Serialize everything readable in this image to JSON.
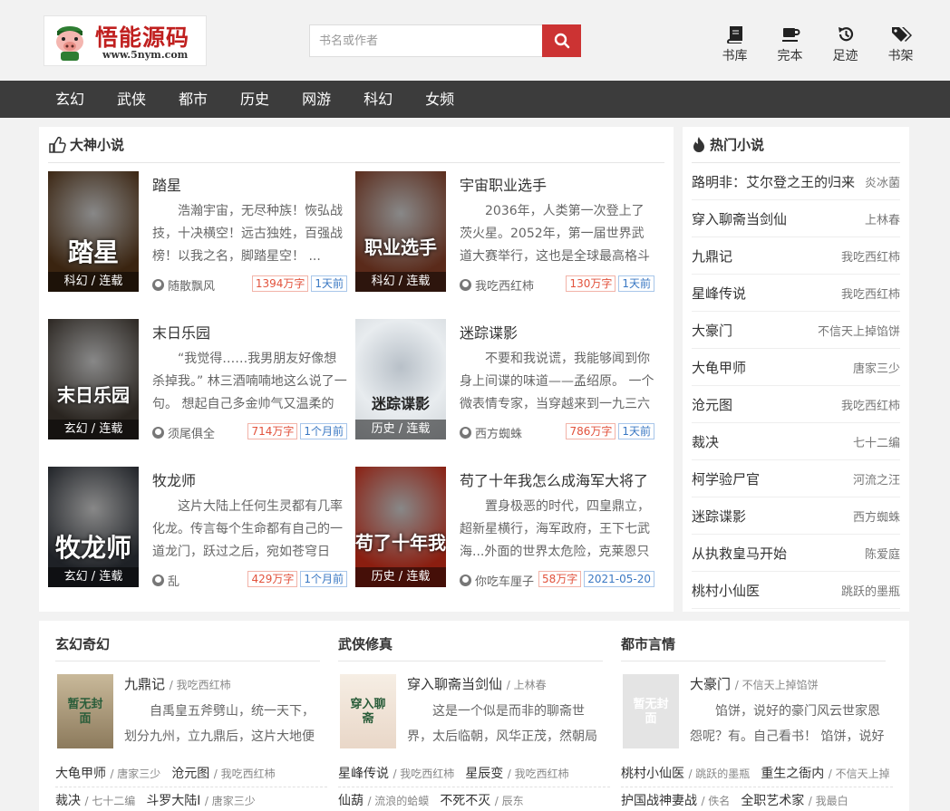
{
  "logo": {
    "title": "悟能源码",
    "url": "www.5nym.com"
  },
  "search": {
    "placeholder": "书名或作者"
  },
  "tools": [
    {
      "label": "书库",
      "icon": "book-icon"
    },
    {
      "label": "完本",
      "icon": "cup-icon"
    },
    {
      "label": "足迹",
      "icon": "history-icon"
    },
    {
      "label": "书架",
      "icon": "tags-icon"
    }
  ],
  "nav": [
    "玄幻",
    "武侠",
    "都市",
    "历史",
    "网游",
    "科幻",
    "女频"
  ],
  "featured": {
    "title": "大神小说",
    "books": [
      {
        "title": "踏星",
        "cover_text": "踏星",
        "tag": "科幻 / 连载",
        "desc": "浩瀚宇宙，无尽种族！恢弘战技，十决横空！远古独姓，百强战榜！以我之名，脚踏星空！ ...",
        "author": "随散飘风",
        "words": "1394万字",
        "time": "1天前",
        "cover_color": "#3a2410"
      },
      {
        "title": "宇宙职业选手",
        "cover_text": "职业选手",
        "tag": "科幻 / 连载",
        "desc": "2036年，人类第一次登上了茨火星。2052年，第一届世界武道大赛举行，这也是全球最高格斗赛",
        "author": "我吃西红柿",
        "words": "130万字",
        "time": "1天前",
        "cover_color": "#5a2a1a"
      },
      {
        "title": "末日乐园",
        "cover_text": "末日乐园",
        "tag": "玄幻 / 连载",
        "desc": "“我觉得……我男朋友好像想杀掉我。” 林三酒喃喃地这么说了一句。 想起自己多金帅气又温柔的",
        "author": "须尾俱全",
        "words": "714万字",
        "time": "1个月前",
        "cover_color": "#2a2520"
      },
      {
        "title": "迷踪谍影",
        "cover_text": "迷踪谍影",
        "tag": "历史 / 连载",
        "desc": "不要和我说谎，我能够闻到你身上间谍的味道——孟绍原。 一个微表情专家，当穿越来到一九三六",
        "author": "西方蜘蛛",
        "words": "786万字",
        "time": "1天前",
        "cover_color": "#d8dde2"
      },
      {
        "title": "牧龙师",
        "cover_text": "牧龙师",
        "tag": "玄幻 / 连载",
        "desc": "这片大陆上任何生灵都有几率化龙。传言每个生命都有自己的一道龙门，跃过之后，宛如苍穹日",
        "author": "乱",
        "words": "429万字",
        "time": "1个月前",
        "cover_color": "#1e2126"
      },
      {
        "title": "苟了十年我怎么成海军大将了",
        "cover_text": "苟了十年我",
        "tag": "历史 / 连载",
        "desc": "置身极恶的时代，四皇鼎立，超新星横行，海军政府，王下七武海...外面的世界太危险，克莱恩只",
        "author": "你吃车厘子",
        "words": "58万字",
        "time": "2021-05-20",
        "cover_color": "#8a1e10"
      }
    ]
  },
  "hot": {
    "title": "热门小说",
    "items": [
      {
        "name": "路明非：艾尔登之王的归来",
        "author": "炎冰菌"
      },
      {
        "name": "穿入聊斋当剑仙",
        "author": "上林春"
      },
      {
        "name": "九鼎记",
        "author": "我吃西红柿"
      },
      {
        "name": "星峰传说",
        "author": "我吃西红柿"
      },
      {
        "name": "大豪门",
        "author": "不信天上掉馅饼"
      },
      {
        "name": "大龟甲师",
        "author": "唐家三少"
      },
      {
        "name": "沧元图",
        "author": "我吃西红柿"
      },
      {
        "name": "裁决",
        "author": "七十二编"
      },
      {
        "name": "柯学验尸官",
        "author": "河流之汪"
      },
      {
        "name": "迷踪谍影",
        "author": "西方蜘蛛"
      },
      {
        "name": "从执救皇马开始",
        "author": "陈爱庭"
      },
      {
        "name": "桃村小仙医",
        "author": "跳跃的墨瓶"
      }
    ]
  },
  "categories": [
    {
      "title": "玄幻奇幻",
      "top": {
        "title": "九鼎记",
        "author": "/ 我吃西红柿",
        "desc": "自禹皇五斧劈山，统一天下，划分九州，立九鼎后，这片大地便被",
        "cover_text": "暂无封面"
      },
      "row1": [
        {
          "name": "大龟甲师",
          "author": "/ 唐家三少"
        },
        {
          "name": "沧元图",
          "author": "/ 我吃西红柿"
        }
      ],
      "row2": [
        {
          "name": "裁决",
          "author": "/ 七十二编"
        },
        {
          "name": "斗罗大陆Ⅰ",
          "author": "/ 唐家三少"
        }
      ]
    },
    {
      "title": "武侠修真",
      "top": {
        "title": "穿入聊斋当剑仙",
        "author": "/ 上林春",
        "desc": "这是一个似是而非的聊斋世界，太后临朝，风华正茂，然朝局动",
        "cover_text": "穿入聊斋"
      },
      "row1": [
        {
          "name": "星峰传说",
          "author": "/ 我吃西红柿"
        },
        {
          "name": "星辰变",
          "author": "/ 我吃西红柿"
        }
      ],
      "row2": [
        {
          "name": "仙葫",
          "author": "/ 流浪的蛤蟆"
        },
        {
          "name": "不死不灭",
          "author": "/ 辰东"
        }
      ]
    },
    {
      "title": "都市言情",
      "top": {
        "title": "大豪门",
        "author": "/ 不信天上掉馅饼",
        "desc": "馅饼，说好的豪门风云世家恩怨呢？有。自己看书！ 馅饼，说好的",
        "cover_text": "暂无封面"
      },
      "row1": [
        {
          "name": "桃村小仙医",
          "author": "/ 跳跃的墨瓶"
        },
        {
          "name": "重生之衙内",
          "author": "/ 不信天上掉"
        }
      ],
      "row2": [
        {
          "name": "护国战神妻战",
          "author": "/ 佚名"
        },
        {
          "name": "全职艺术家",
          "author": "/ 我最白"
        }
      ]
    }
  ]
}
